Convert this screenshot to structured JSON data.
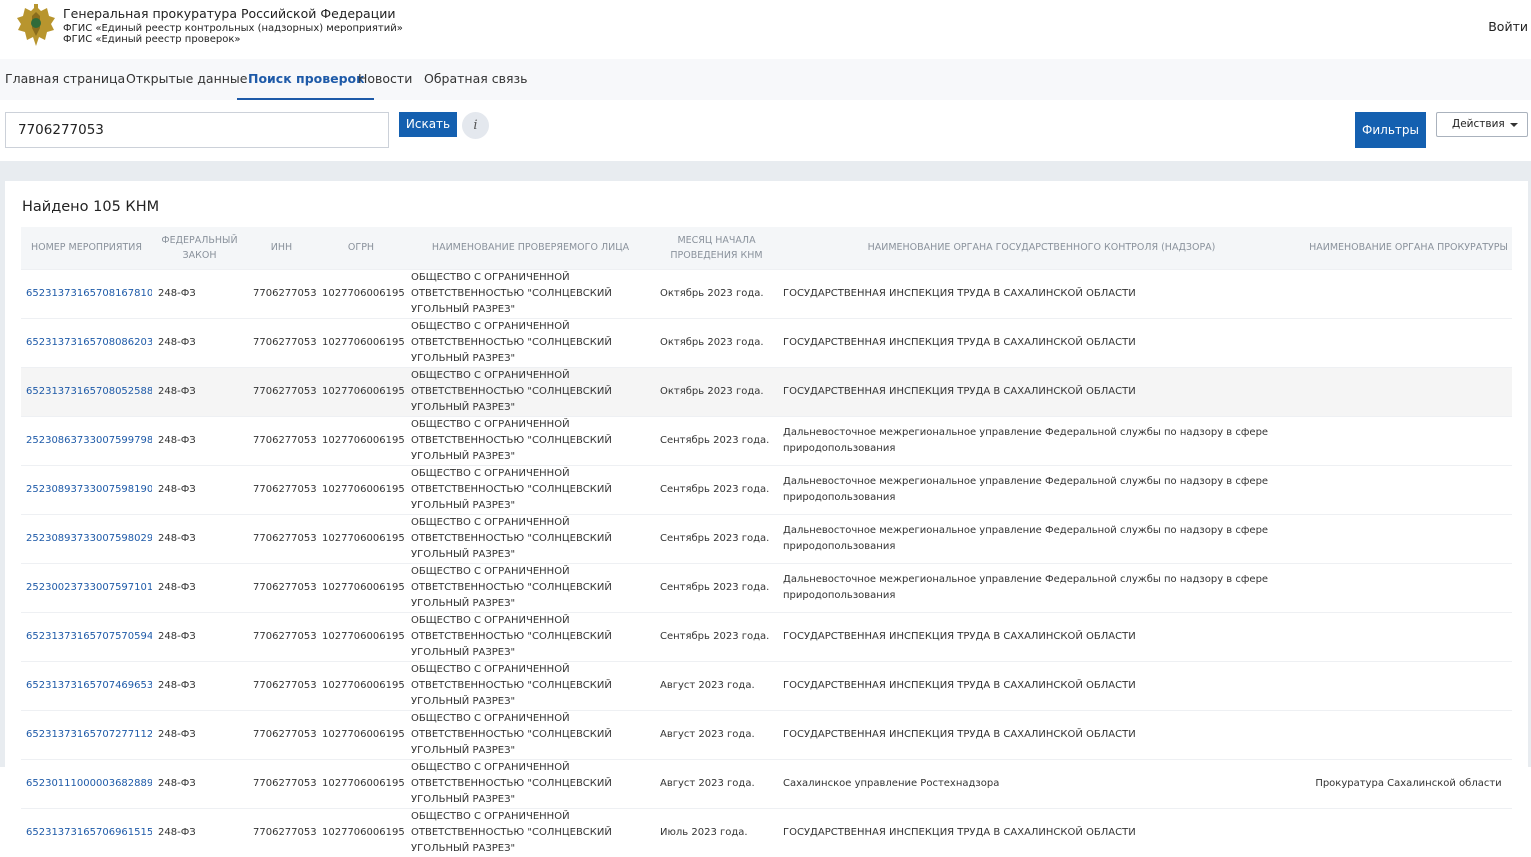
{
  "header": {
    "title": "Генеральная прокуратура Российской Федерации",
    "subtitle1": "ФГИС «Единый реестр контрольных (надзорных) мероприятий»",
    "subtitle2": "ФГИС «Единый реестр проверок»",
    "login": "Войти",
    "emblem_icon": "coat-of-arms-icon"
  },
  "nav": {
    "items": [
      {
        "label": "Главная страница"
      },
      {
        "label": "Открытые данные"
      },
      {
        "label": "Поиск проверок"
      },
      {
        "label": "Новости"
      },
      {
        "label": "Обратная связь"
      }
    ],
    "active": "Поиск проверок"
  },
  "search": {
    "value": "7706277053",
    "button": "Искать",
    "info": "i",
    "filters": "Фильтры",
    "actions": "Действия"
  },
  "results": {
    "found": "Найдено 105 КНМ",
    "columns": [
      "Номер мероприятия",
      "Федеральный закон",
      "ИНН",
      "ОГРН",
      "Наименование проверяемого лица",
      "Месяц начала проведения КНМ",
      "Наименование органа государственного контроля (надзора)",
      "Наименование органа прокуратуры"
    ],
    "rows": [
      [
        "65231373165708167810",
        "248-ФЗ",
        "7706277053",
        "1027706006195",
        "ОБЩЕСТВО С ОГРАНИЧЕННОЙ ОТВЕТСТВЕННОСТЬЮ \"СОЛНЦЕВСКИЙ УГОЛЬНЫЙ РАЗРЕЗ\"",
        "Октябрь 2023 года.",
        "ГОСУДАРСТВЕННАЯ ИНСПЕКЦИЯ ТРУДА В САХАЛИНСКОЙ ОБЛАСТИ",
        ""
      ],
      [
        "65231373165708086203",
        "248-ФЗ",
        "7706277053",
        "1027706006195",
        "ОБЩЕСТВО С ОГРАНИЧЕННОЙ ОТВЕТСТВЕННОСТЬЮ \"СОЛНЦЕВСКИЙ УГОЛЬНЫЙ РАЗРЕЗ\"",
        "Октябрь 2023 года.",
        "ГОСУДАРСТВЕННАЯ ИНСПЕКЦИЯ ТРУДА В САХАЛИНСКОЙ ОБЛАСТИ",
        ""
      ],
      [
        "65231373165708052588",
        "248-ФЗ",
        "7706277053",
        "1027706006195",
        "ОБЩЕСТВО С ОГРАНИЧЕННОЙ ОТВЕТСТВЕННОСТЬЮ \"СОЛНЦЕВСКИЙ УГОЛЬНЫЙ РАЗРЕЗ\"",
        "Октябрь 2023 года.",
        "ГОСУДАРСТВЕННАЯ ИНСПЕКЦИЯ ТРУДА В САХАЛИНСКОЙ ОБЛАСТИ",
        ""
      ],
      [
        "25230863733007599798",
        "248-ФЗ",
        "7706277053",
        "1027706006195",
        "ОБЩЕСТВО С ОГРАНИЧЕННОЙ ОТВЕТСТВЕННОСТЬЮ \"СОЛНЦЕВСКИЙ УГОЛЬНЫЙ РАЗРЕЗ\"",
        "Сентябрь 2023 года.",
        "Дальневосточное межрегиональное управление Федеральной службы по надзору в сфере природопользования",
        ""
      ],
      [
        "25230893733007598190",
        "248-ФЗ",
        "7706277053",
        "1027706006195",
        "ОБЩЕСТВО С ОГРАНИЧЕННОЙ ОТВЕТСТВЕННОСТЬЮ \"СОЛНЦЕВСКИЙ УГОЛЬНЫЙ РАЗРЕЗ\"",
        "Сентябрь 2023 года.",
        "Дальневосточное межрегиональное управление Федеральной службы по надзору в сфере природопользования",
        ""
      ],
      [
        "25230893733007598029",
        "248-ФЗ",
        "7706277053",
        "1027706006195",
        "ОБЩЕСТВО С ОГРАНИЧЕННОЙ ОТВЕТСТВЕННОСТЬЮ \"СОЛНЦЕВСКИЙ УГОЛЬНЫЙ РАЗРЕЗ\"",
        "Сентябрь 2023 года.",
        "Дальневосточное межрегиональное управление Федеральной службы по надзору в сфере природопользования",
        ""
      ],
      [
        "25230023733007597101",
        "248-ФЗ",
        "7706277053",
        "1027706006195",
        "ОБЩЕСТВО С ОГРАНИЧЕННОЙ ОТВЕТСТВЕННОСТЬЮ \"СОЛНЦЕВСКИЙ УГОЛЬНЫЙ РАЗРЕЗ\"",
        "Сентябрь 2023 года.",
        "Дальневосточное межрегиональное управление Федеральной службы по надзору в сфере природопользования",
        ""
      ],
      [
        "65231373165707570594",
        "248-ФЗ",
        "7706277053",
        "1027706006195",
        "ОБЩЕСТВО С ОГРАНИЧЕННОЙ ОТВЕТСТВЕННОСТЬЮ \"СОЛНЦЕВСКИЙ УГОЛЬНЫЙ РАЗРЕЗ\"",
        "Сентябрь 2023 года.",
        "ГОСУДАРСТВЕННАЯ ИНСПЕКЦИЯ ТРУДА В САХАЛИНСКОЙ ОБЛАСТИ",
        ""
      ],
      [
        "65231373165707469653",
        "248-ФЗ",
        "7706277053",
        "1027706006195",
        "ОБЩЕСТВО С ОГРАНИЧЕННОЙ ОТВЕТСТВЕННОСТЬЮ \"СОЛНЦЕВСКИЙ УГОЛЬНЫЙ РАЗРЕЗ\"",
        "Август 2023 года.",
        "ГОСУДАРСТВЕННАЯ ИНСПЕКЦИЯ ТРУДА В САХАЛИНСКОЙ ОБЛАСТИ",
        ""
      ],
      [
        "65231373165707277112",
        "248-ФЗ",
        "7706277053",
        "1027706006195",
        "ОБЩЕСТВО С ОГРАНИЧЕННОЙ ОТВЕТСТВЕННОСТЬЮ \"СОЛНЦЕВСКИЙ УГОЛЬНЫЙ РАЗРЕЗ\"",
        "Август 2023 года.",
        "ГОСУДАРСТВЕННАЯ ИНСПЕКЦИЯ ТРУДА В САХАЛИНСКОЙ ОБЛАСТИ",
        ""
      ],
      [
        "65230111000003682889",
        "248-ФЗ",
        "7706277053",
        "1027706006195",
        "ОБЩЕСТВО С ОГРАНИЧЕННОЙ ОТВЕТСТВЕННОСТЬЮ \"СОЛНЦЕВСКИЙ УГОЛЬНЫЙ РАЗРЕЗ\"",
        "Август 2023 года.",
        "Сахалинское управление Ростехнадзора",
        "Прокуратура Сахалинской области"
      ],
      [
        "65231373165706961515",
        "248-ФЗ",
        "7706277053",
        "1027706006195",
        "ОБЩЕСТВО С ОГРАНИЧЕННОЙ ОТВЕТСТВЕННОСТЬЮ \"СОЛНЦЕВСКИЙ УГОЛЬНЫЙ РАЗРЕЗ\"",
        "Июль 2023 года.",
        "ГОСУДАРСТВЕННАЯ ИНСПЕКЦИЯ ТРУДА В САХАЛИНСКОЙ ОБЛАСТИ",
        ""
      ]
    ],
    "highlighted_row": 2
  },
  "colors": {
    "accent": "#1460b0",
    "link": "#1e5aa8",
    "band": "#e8ecf0"
  }
}
